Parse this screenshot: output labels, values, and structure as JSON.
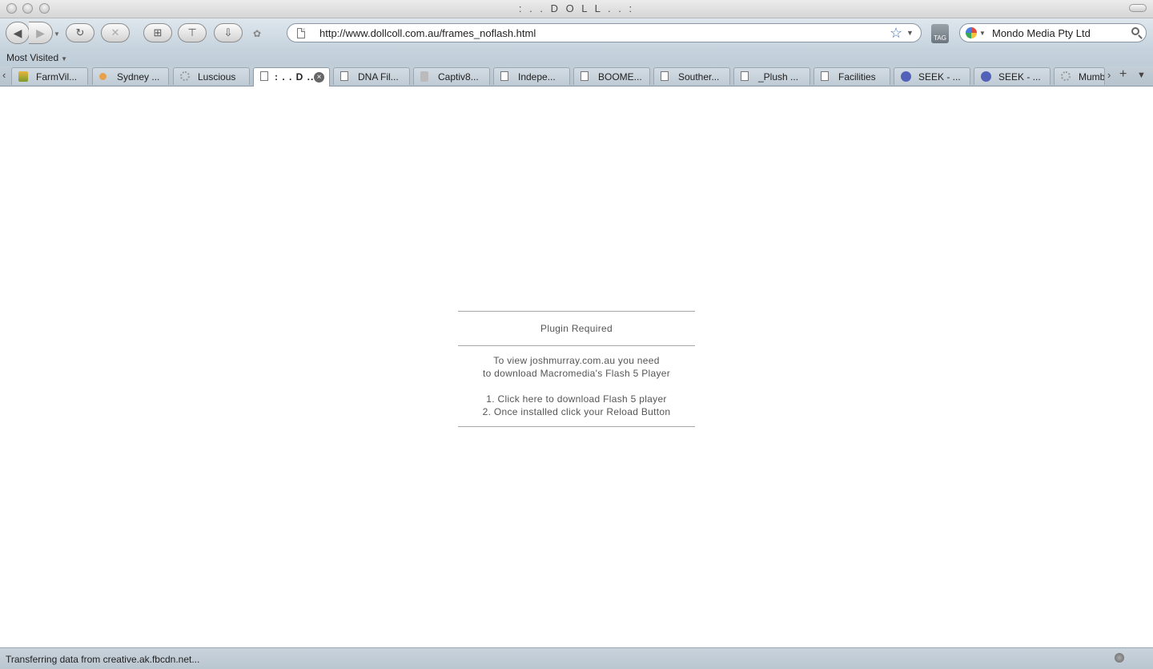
{
  "window": {
    "title": ": . . D O L L . . :"
  },
  "toolbar": {
    "url": "http://www.dollcoll.com.au/frames_noflash.html",
    "tag_label": "TAG",
    "search_value": "Mondo Media Pty Ltd"
  },
  "bookmarks": {
    "most_visited": "Most Visited"
  },
  "tabs": [
    {
      "label": "FarmVil...",
      "icon": "farm-icon"
    },
    {
      "label": "Sydney ...",
      "icon": "dot-icon"
    },
    {
      "label": "Luscious",
      "icon": "loading-icon"
    },
    {
      "label": ": . . D ...",
      "icon": "page-icon",
      "active": true
    },
    {
      "label": "DNA Fil...",
      "icon": "page-icon"
    },
    {
      "label": "Captiv8...",
      "icon": "person-icon"
    },
    {
      "label": "Indepe...",
      "icon": "page-icon"
    },
    {
      "label": "BOOME...",
      "icon": "page-icon"
    },
    {
      "label": "Souther...",
      "icon": "page-icon"
    },
    {
      "label": "_Plush ...",
      "icon": "page-icon"
    },
    {
      "label": "Facilities",
      "icon": "page-icon"
    },
    {
      "label": "SEEK - ...",
      "icon": "globe-icon"
    },
    {
      "label": "SEEK - ...",
      "icon": "globe-icon"
    },
    {
      "label": "Mumb",
      "icon": "loading-icon"
    }
  ],
  "content": {
    "title": "Plugin Required",
    "line1": "To view joshmurray.com.au you need",
    "line2": "to download Macromedia's Flash 5 Player",
    "step1": "1. Click here to download Flash 5 player",
    "step2": "2. Once installed click your Reload Button"
  },
  "status": {
    "text": "Transferring data from creative.ak.fbcdn.net..."
  }
}
